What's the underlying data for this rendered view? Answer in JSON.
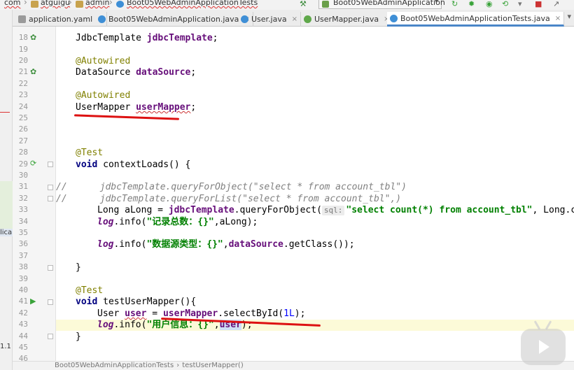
{
  "navbar": {
    "crumbs": [
      "com",
      "atguigu",
      "admin",
      "Boot05WebAdminApplicationTests"
    ],
    "run_config": "Boot05WebAdminApplication"
  },
  "tabs": [
    {
      "label": "application.yaml",
      "icon": "yaml-file-icon",
      "active": false
    },
    {
      "label": "Boot05WebAdminApplication.java",
      "icon": "class-icon",
      "active": false
    },
    {
      "label": "User.java",
      "icon": "class-icon",
      "active": false
    },
    {
      "label": "UserMapper.java",
      "icon": "interface-icon",
      "active": false
    },
    {
      "label": "Boot05WebAdminApplicationTests.java",
      "icon": "class-icon",
      "active": true
    }
  ],
  "left_strip": {
    "text1": "lica",
    "text2": "1.1"
  },
  "editor": {
    "line_numbers": [
      "18",
      "19",
      "20",
      "21",
      "22",
      "23",
      "24",
      "25",
      "26",
      "27",
      "28",
      "29",
      "30",
      "31",
      "32",
      "33",
      "34",
      "35",
      "36",
      "37",
      "38",
      "39",
      "40",
      "41",
      "42",
      "43",
      "44",
      "45",
      "46"
    ],
    "lines": {
      "l18": {
        "type": "JdbcTemplate",
        "name": "jdbcTemplate",
        "end": ";"
      },
      "l20": "@Autowired",
      "l21": {
        "type": "DataSource",
        "name": "dataSource",
        "end": ";"
      },
      "l23": "@Autowired",
      "l24": {
        "type": "UserMapper",
        "name": "userMapper",
        "end": ";"
      },
      "l28": "@Test",
      "l29": {
        "kw": "void",
        "rest": "contextLoads() {"
      },
      "l31": {
        "prefix": "//",
        "body": "jdbcTemplate.queryForObject(\"select * from account_tbl\")"
      },
      "l32": {
        "prefix": "//",
        "body": "jdbcTemplate.queryForList(\"select * from account_tbl\",)"
      },
      "l33": {
        "a": "Long aLong = ",
        "field": "jdbcTemplate",
        "b": ".queryForObject(",
        "hint": "sql:",
        "str": "\"select count(*) from account_tbl\"",
        "c": ", Long.cl"
      },
      "l34": {
        "log": "log",
        "a": ".info(",
        "str": "\"记录总数：{}\"",
        "b": ",aLong);"
      },
      "l36": {
        "log": "log",
        "a": ".info(",
        "str": "\"数据源类型：{}\"",
        "b": ",",
        "field": "dataSource",
        "c": ".getClass());"
      },
      "l38": "}",
      "l40": "@Test",
      "l41": {
        "kw": "void",
        "rest": "testUserMapper(){"
      },
      "l42": {
        "a": "User ",
        "var": "user",
        "b": " = ",
        "field": "userMapper",
        "c": ".selectById(",
        "num": "1L",
        "d": ");"
      },
      "l43": {
        "log": "log",
        "a": ".info(",
        "str": "\"用户信息：{}\"",
        "b": ",",
        "var": "user",
        "c": ");"
      },
      "l44": "}"
    }
  },
  "status_breadcrumb": {
    "class_name": "Boot05WebAdminApplicationTests",
    "arrow": "›",
    "method": "testUserMapper()"
  },
  "colors": {
    "keyword": "#000080",
    "annotation": "#808000",
    "field": "#660e7a",
    "string": "#008000",
    "comment": "#808080",
    "number": "#0000ff",
    "annotation_pen": "#dd1111"
  }
}
